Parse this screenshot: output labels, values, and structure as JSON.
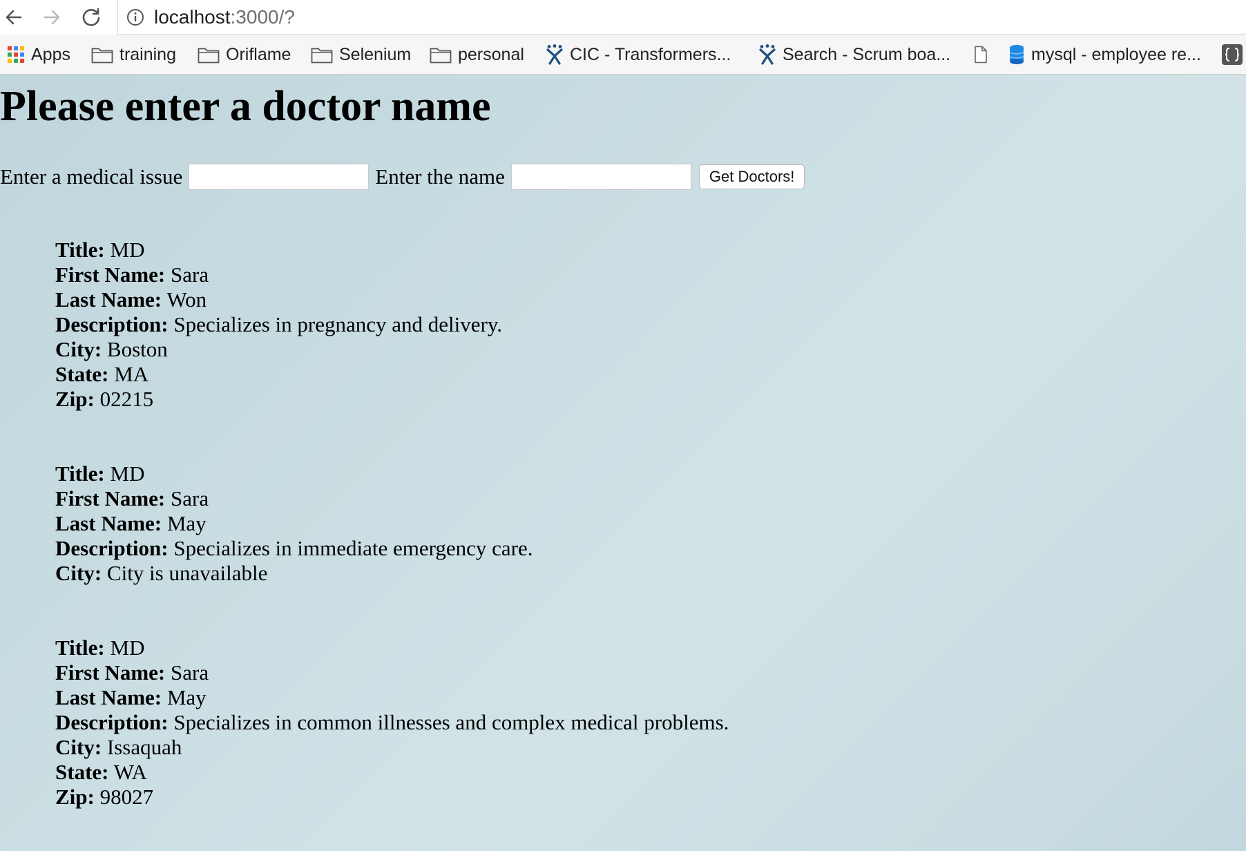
{
  "browser": {
    "url_host": "localhost",
    "url_path": ":3000/?",
    "bookmarks": {
      "apps": "Apps",
      "training": "training",
      "oriflame": "Oriflame",
      "selenium": "Selenium",
      "personal": "personal",
      "cic": "CIC - Transformers...",
      "search": "Search - Scrum boa...",
      "mysql": "mysql - employee re..."
    }
  },
  "page": {
    "title": "Please enter a doctor name",
    "form": {
      "issue_label": "Enter a medical issue",
      "issue_value": "",
      "name_label": "Enter the name",
      "name_value": "",
      "submit_label": "Get Doctors!"
    },
    "labels": {
      "title": "Title:",
      "first_name": "First Name:",
      "last_name": "Last Name:",
      "description": "Description:",
      "city": "City:",
      "state": "State:",
      "zip": "Zip:"
    },
    "doctors": [
      {
        "title": "MD",
        "first_name": "Sara",
        "last_name": "Won",
        "description": "Specializes in pregnancy and delivery.",
        "city": "Boston",
        "state": "MA",
        "zip": "02215"
      },
      {
        "title": "MD",
        "first_name": "Sara",
        "last_name": "May",
        "description": "Specializes in immediate emergency care.",
        "city": "City is unavailable"
      },
      {
        "title": "MD",
        "first_name": "Sara",
        "last_name": "May",
        "description": "Specializes in common illnesses and complex medical problems.",
        "city": "Issaquah",
        "state": "WA",
        "zip": "98027"
      }
    ]
  },
  "colors": {
    "page_background": "#c9dde2",
    "bookmark_bar": "#f6f6f6"
  }
}
